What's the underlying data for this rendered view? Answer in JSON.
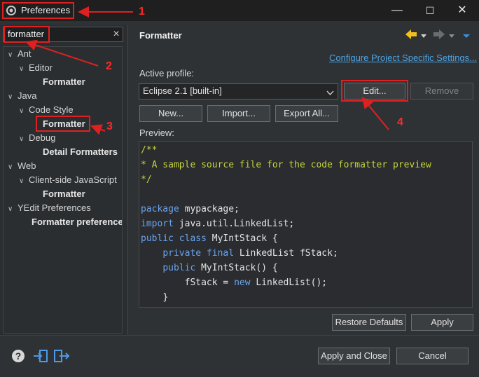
{
  "window": {
    "title": "Preferences",
    "minimize": "—",
    "maximize": "☐",
    "close": "✕"
  },
  "filter": {
    "value": "formatter",
    "clear": "×"
  },
  "tree": [
    {
      "label": "Ant",
      "arrow": "∨"
    },
    {
      "label": "Editor",
      "arrow": "∨"
    },
    {
      "label": "Formatter"
    },
    {
      "label": "Java",
      "arrow": "∨"
    },
    {
      "label": "Code Style",
      "arrow": "∨"
    },
    {
      "label": "Formatter"
    },
    {
      "label": "Debug",
      "arrow": "∨"
    },
    {
      "label": "Detail Formatters"
    },
    {
      "label": "Web",
      "arrow": "∨"
    },
    {
      "label": "Client-side JavaScript",
      "arrow": "∨"
    },
    {
      "label": "Formatter"
    },
    {
      "label": "YEdit Preferences",
      "arrow": "∨"
    },
    {
      "label": "Formatter preference"
    }
  ],
  "page": {
    "title": "Formatter",
    "configure_link": "Configure Project Specific Settings...",
    "active_profile_label": "Active profile:",
    "profile_value": "Eclipse 2.1 [built-in]",
    "edit": "Edit...",
    "remove": "Remove",
    "new": "New...",
    "import": "Import...",
    "export": "Export All...",
    "preview_label": "Preview:",
    "restore_defaults": "Restore Defaults",
    "apply": "Apply"
  },
  "preview_code": [
    {
      "text": "/**",
      "cls": "cmt"
    },
    {
      "text": "* A sample source file for the code formatter preview",
      "cls": "cmt"
    },
    {
      "text": "*/",
      "cls": "cmt"
    },
    {
      "text": "",
      "cls": "plain"
    },
    {
      "kw": "package",
      "rest": " mypackage;"
    },
    {
      "kw": "import",
      "rest": " java.util.LinkedList;"
    },
    {
      "kw": "public class",
      "rest": " MyIntStack {"
    },
    {
      "indent": "    ",
      "kw": "private final",
      "rest": " LinkedList fStack;"
    },
    {
      "indent": "    ",
      "kw": "public",
      "rest": " MyIntStack() {"
    },
    {
      "indent": "        ",
      "pre": "fStack = ",
      "kw": "new",
      "rest": " LinkedList();"
    },
    {
      "indent": "    ",
      "rest": "}"
    }
  ],
  "footer": {
    "apply_close": "Apply and Close",
    "cancel": "Cancel"
  },
  "annotations": {
    "n1": "1",
    "n2": "2",
    "n3": "3",
    "n4": "4"
  },
  "colors": {
    "callout": "#e02020",
    "link": "#4ba3e3",
    "comment": "#c6d33a",
    "keyword": "#6aa3ee"
  }
}
